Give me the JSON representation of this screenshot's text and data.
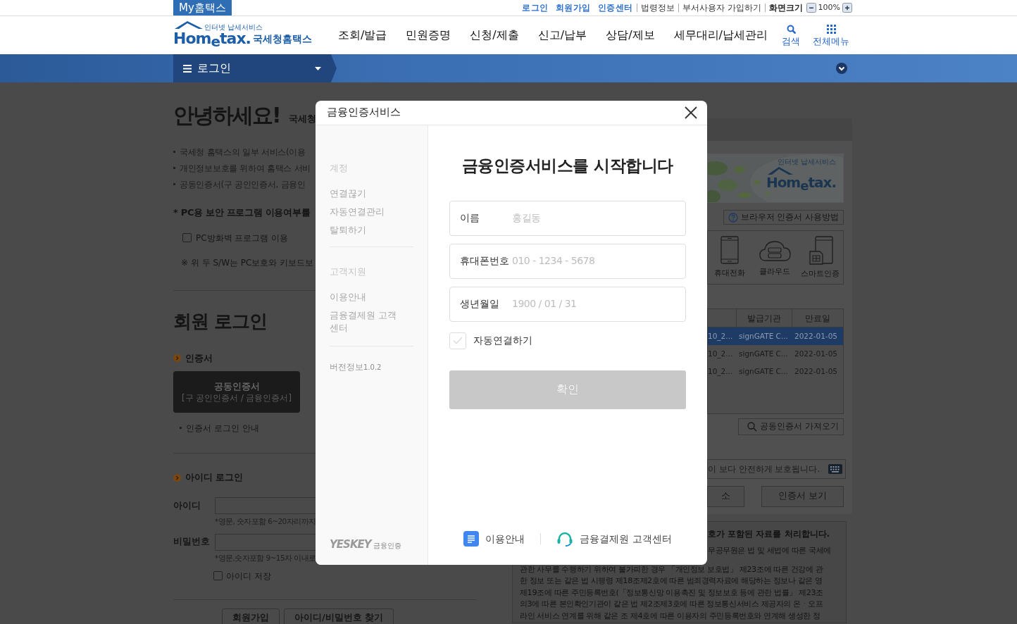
{
  "top_bar": {
    "brand": "My홈택스",
    "links": [
      {
        "label": "로그인",
        "kind": "primary"
      },
      {
        "label": "회원가입",
        "kind": "primary"
      },
      {
        "label": "인증센터",
        "kind": "primary"
      },
      {
        "label": "법령정보",
        "kind": "plain"
      },
      {
        "label": "부서사용자 가입하기",
        "kind": "plain"
      }
    ],
    "zoom": {
      "label": "화면크기",
      "value": "100%"
    }
  },
  "header": {
    "logo": {
      "tagline": "인터넷 납세서비스",
      "wordmark": "Hom$_{e}$tax.",
      "name": "국세청홈택스"
    },
    "menu": [
      "조회/발급",
      "민원증명",
      "신청/제출",
      "신고/납부",
      "상담/제보",
      "세무대리/납세관리"
    ],
    "tools": [
      {
        "label": "검색",
        "kind": "search"
      },
      {
        "label": "전체메뉴",
        "kind": "grid"
      }
    ]
  },
  "login_bar": {
    "label": "로그인"
  },
  "welcome": {
    "title": "안녕하세요!",
    "subtitle": "국세청",
    "notes": [
      "국세청 홈택스의 일부 서비스(이용",
      "개인정보보호를 위하여 홈택스 서비",
      "공동인증서(구 공인인증서, 금융인"
    ]
  },
  "security": {
    "title": "* PC용 보안 프로그램 이용여부를",
    "options": [
      {
        "label": "PC방화벽 프로그램 이용",
        "checked": false
      }
    ],
    "note": "※ 위 두 S/W는 PC보호와 키보드보"
  },
  "member_login": {
    "title": "회원 로그인",
    "cert": {
      "heading": "인증서",
      "button_title": "공동인증서",
      "button_subtitle": "[구 공인인증서 / 금융인증서]",
      "guide": "인증서 로그인 안내"
    },
    "id_login": {
      "heading": "아이디 로그인",
      "fields": [
        {
          "label": "아이디",
          "hint": "*영문, 숫자포함 6~20자리까지"
        },
        {
          "label": "비밀번호",
          "hint": "*영문,숫자포함 9~15자 이내로"
        }
      ],
      "save_id": {
        "label": "아이디 저장",
        "checked": false
      }
    },
    "buttons": [
      "회원가입",
      "아이디/비밀번호 찾기"
    ]
  },
  "cert_panel": {
    "banner": {
      "kind": "picture",
      "logo_tagline": "인터넷 납세서비스",
      "logo_wordmark": "Hom$_{e}$tax."
    },
    "help_button": "브라우저 인증서 사용방법",
    "media": [
      {
        "label": "휴대전화",
        "kind": "phone"
      },
      {
        "label": "클라우드",
        "kind": "cloud"
      },
      {
        "label": "스마트인증",
        "kind": "smart"
      }
    ],
    "table": {
      "columns": [
        "",
        "발급기관",
        "만료일"
      ],
      "rows": [
        {
          "cells": [
            "10_2...",
            "signGATE C...",
            "2022-01-05"
          ],
          "selected": true
        },
        {
          "cells": [
            "10_2...",
            "signGATE C...",
            "2022-01-05"
          ],
          "selected": false
        },
        {
          "cells": [
            "10_2...",
            "signGATE C...",
            "2022-01-05"
          ],
          "selected": false
        }
      ]
    },
    "import_button": "공동인증서 가져오기",
    "password_note": "이 보다 안전하게 보호됩니다.",
    "buttons": [
      "소",
      "인증서 보기"
    ]
  },
  "notice": {
    "title": "호가 포함된 자료를 처리합니다.",
    "first_line": "무공무원은 법 및 세법에 따른 국세에",
    "lines": [
      "관한 사무를 수행하기 위하여 불가피한 경우 「개인정보 보호법」 제23조에 따른 건강에 관",
      "한 정보 또는 같은 법 시행령 제18조제2호에 따른 범죄경력자료에 해당하는 정보나 같은 영",
      "제19조에 따른 주민등록번호(「정보통신망 이용촉진 및 정보보호 등에 관한 법률」 제23조",
      "의3에 따른 본인확인기관이 같은 법 제2조제3호에 따른 정보통신서비스 제공자의 온ㆍ오프",
      "라인 서비스 연계를 위해 같은 조 제4호에 따른 이용자의 주민등록번호와 연계해 생성한 정"
    ]
  },
  "modal": {
    "title": "금융인증서비스",
    "sidebar": {
      "sections": [
        {
          "heading": "계정",
          "items": [
            "연결끊기",
            "자동연결관리",
            "탈퇴하기"
          ]
        },
        {
          "heading": "고객지원",
          "items": [
            "이용안내",
            "금융결제원 고객센터"
          ]
        }
      ],
      "version_label": "버전정보",
      "version": "1.0.2",
      "brand": "YESKEY",
      "brand_sub": "금융인증"
    },
    "heading": "금융인증서비스를 시작합니다",
    "fields": [
      {
        "label": "이름",
        "placeholder": "홍길동"
      },
      {
        "label": "휴대폰번호",
        "placeholder": "010 - 1234 - 5678"
      },
      {
        "label": "생년월일",
        "placeholder": "1900 / 01 / 31"
      }
    ],
    "auto_connect": {
      "label": "자동연결하기",
      "checked": false
    },
    "confirm": {
      "label": "확인",
      "disabled": true
    },
    "footer_links": [
      {
        "label": "이용안내",
        "kind": "guide"
      },
      {
        "label": "금융결제원 고객센터",
        "kind": "support"
      }
    ]
  }
}
